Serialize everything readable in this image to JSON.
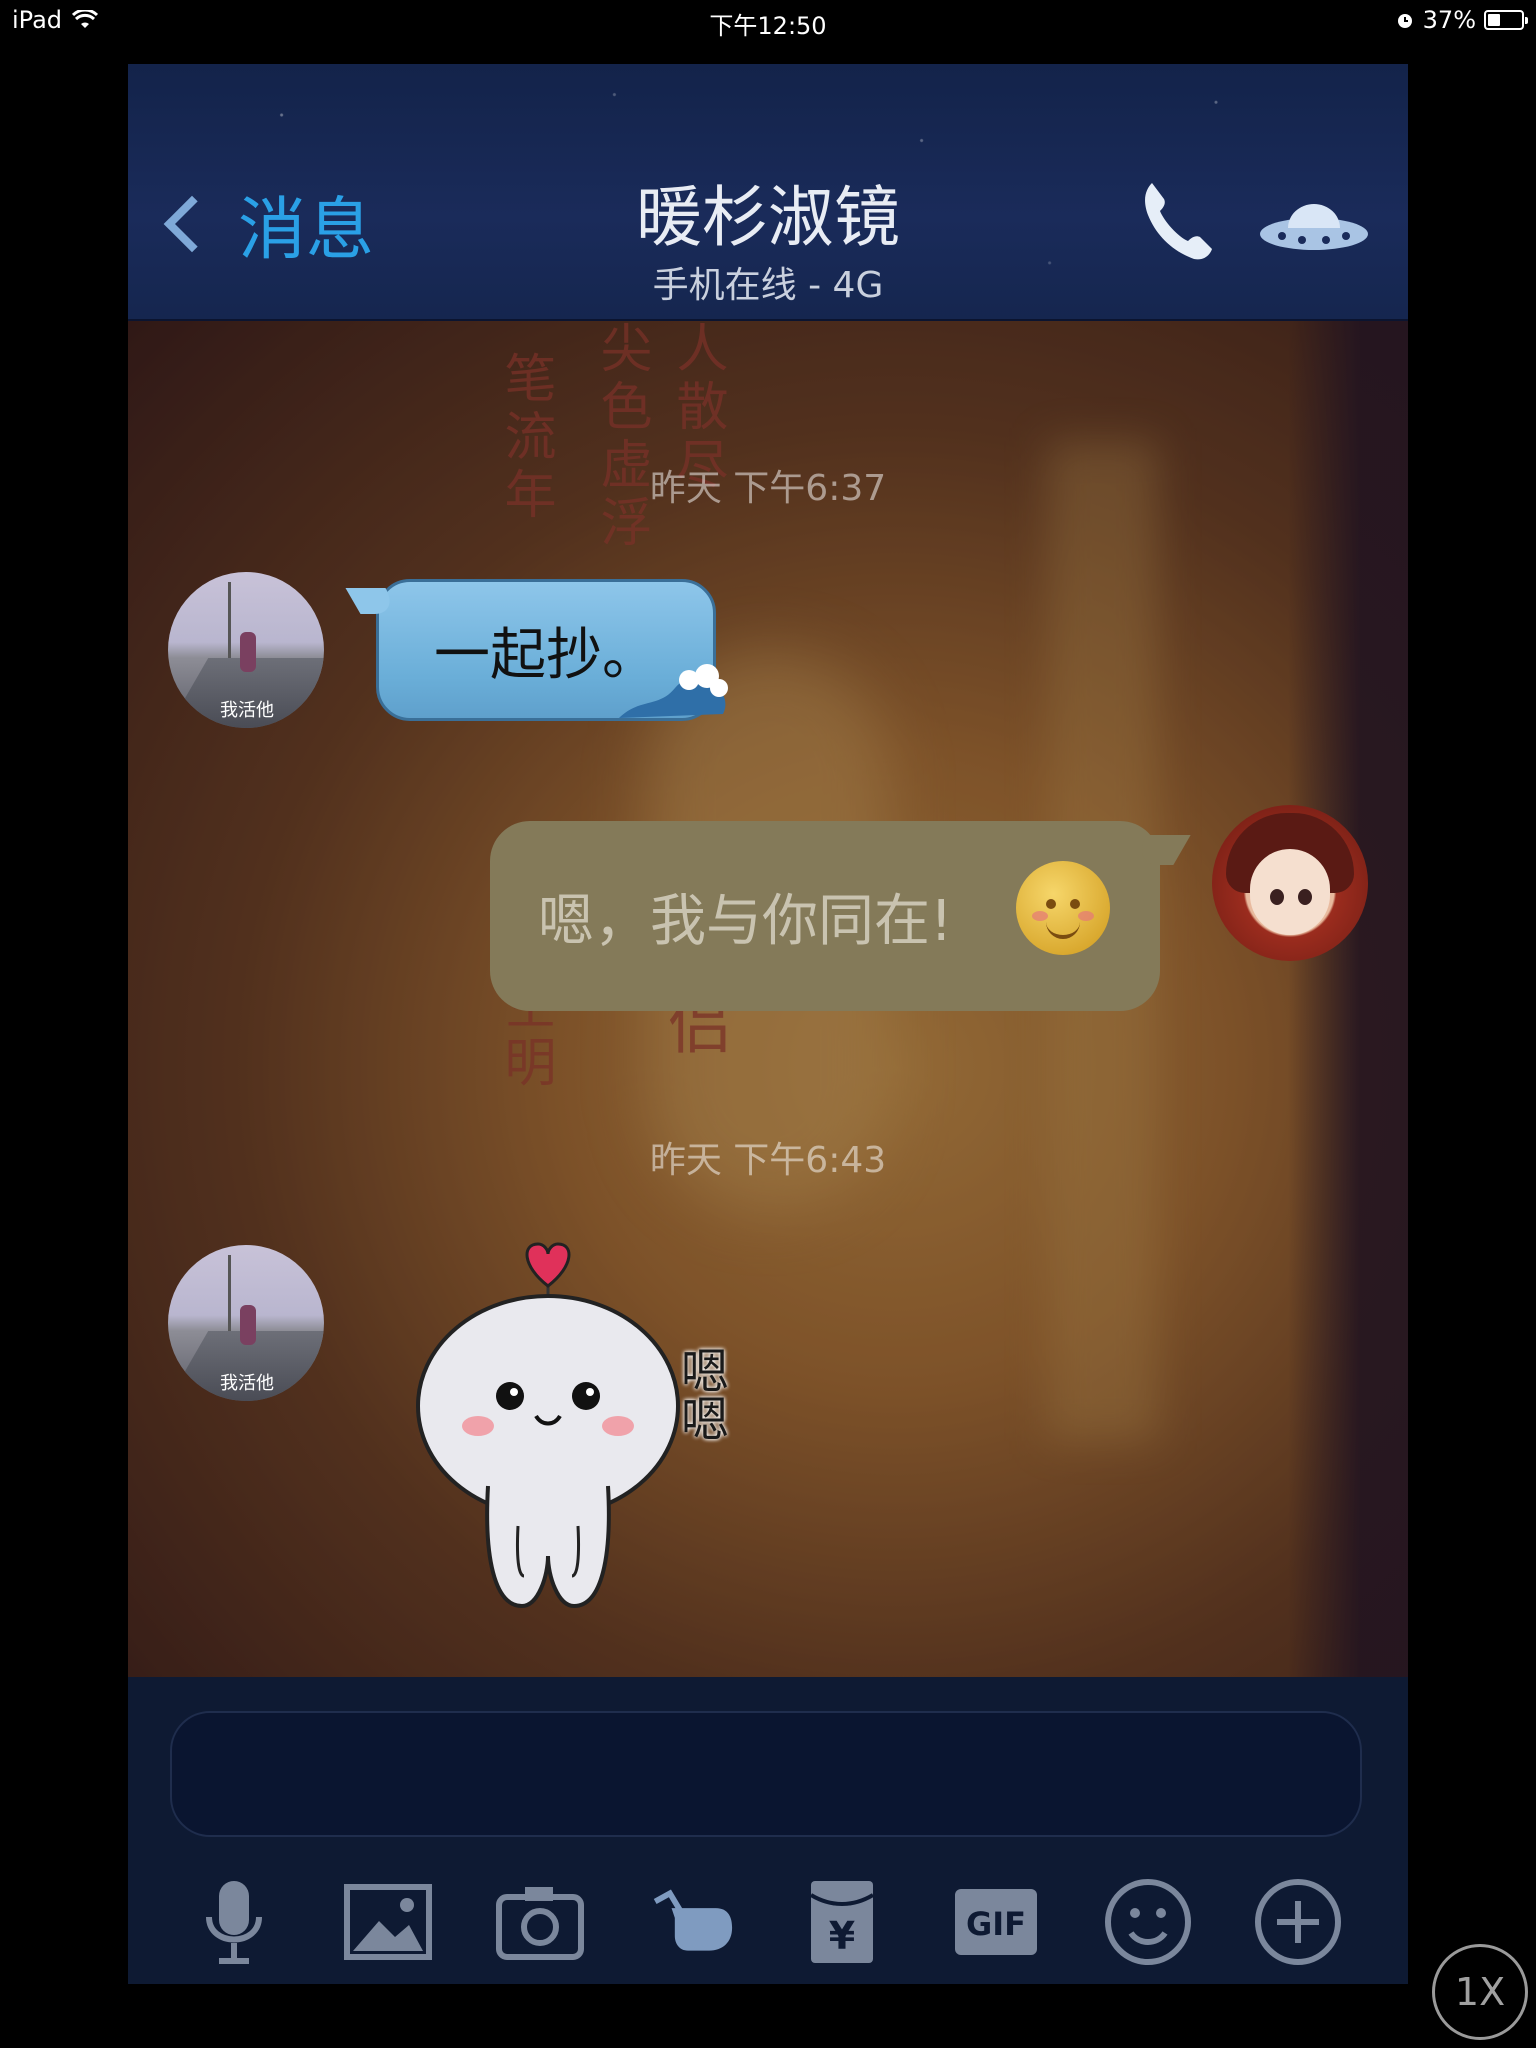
{
  "status_bar": {
    "device": "iPad",
    "time": "下午12:50",
    "battery": "37%",
    "battery_level": 0.37
  },
  "nav": {
    "back_label": "消息",
    "title": "暖杉淑镜",
    "subtitle": "手机在线 - 4G"
  },
  "chat": {
    "timestamp1": "昨天 下午6:37",
    "timestamp2": "昨天 下午6:43",
    "msg1": "一起抄。",
    "msg2": "嗯，我与你同在!",
    "sticker_text": "嗯嗯",
    "background_text_1": "笔流年",
    "background_text_2": "尖色虚浮",
    "background_text_3": "人散尽",
    "background_text_4": "随看空明",
    "background_text_5": "侠侣",
    "avatar_left_signature": "我活他"
  },
  "toolbar": {
    "icons": [
      "microphone-icon",
      "image-icon",
      "camera-icon",
      "poke-hand-icon",
      "red-packet-icon",
      "gif-icon",
      "emoji-icon",
      "plus-icon"
    ],
    "gif_label": "GIF",
    "red_packet_symbol": "¥"
  },
  "speed_button": "1X",
  "colors": {
    "nav_bg": "#1a2b5a",
    "accent": "#2aa0e6",
    "bubble_in": "#8ec6ea",
    "bubble_out": "#847a59",
    "input_bg": "#0e1a33"
  }
}
